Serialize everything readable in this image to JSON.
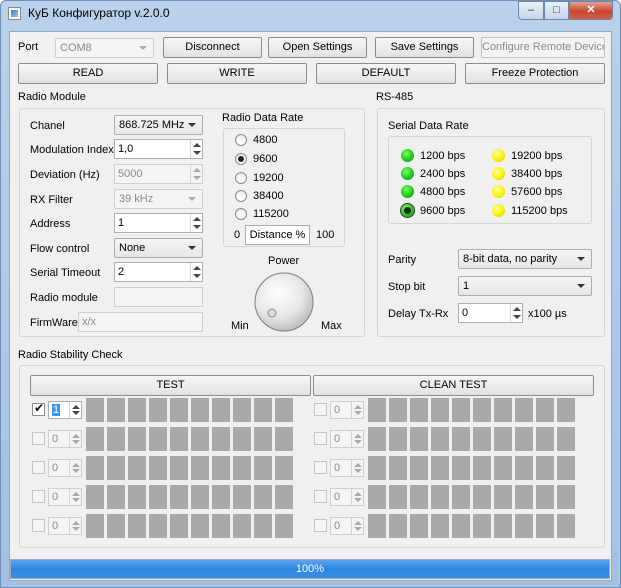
{
  "window": {
    "title": "КуБ Конфигуратор v.2.0.0",
    "buttons": {
      "minimize": "–",
      "maximize": "□",
      "close": "✕"
    }
  },
  "toolbar": {
    "port_label": "Port",
    "port_value": "COM8",
    "disconnect": "Disconnect",
    "open_settings": "Open Settings",
    "save_settings": "Save Settings",
    "configure_remote": "Configure Remote Device",
    "read": "READ",
    "write": "WRITE",
    "default": "DEFAULT",
    "freeze_protection": "Freeze Protection"
  },
  "radio_module": {
    "title": "Radio Module",
    "fields": {
      "chanel_label": "Chanel",
      "chanel_value": "868.725 MHz",
      "modulation_label": "Modulation Index",
      "modulation_value": "1,0",
      "deviation_label": "Deviation (Hz)",
      "deviation_value": "5000",
      "rx_filter_label": "RX Filter",
      "rx_filter_value": "39 kHz",
      "address_label": "Address",
      "address_value": "1",
      "flow_label": "Flow control",
      "flow_value": "None",
      "timeout_label": "Serial Timeout",
      "timeout_value": "2",
      "radio_module_label": "Radio module",
      "radio_module_value": "",
      "firmware_label": "FirmWare",
      "firmware_value": "x/x"
    },
    "data_rate": {
      "title": "Radio Data Rate",
      "options": [
        "4800",
        "9600",
        "19200",
        "38400",
        "115200"
      ],
      "selected": "9600",
      "distance_min": "0",
      "distance_label": "Distance %",
      "distance_max": "100"
    },
    "power": {
      "label": "Power",
      "min": "Min",
      "max": "Max"
    }
  },
  "rs485": {
    "title": "RS-485",
    "serial_rate_title": "Serial Data Rate",
    "rates_left": [
      "1200 bps",
      "2400 bps",
      "4800 bps",
      "9600 bps"
    ],
    "rates_right": [
      "19200 bps",
      "38400 bps",
      "57600 bps",
      "115200 bps"
    ],
    "selected": "9600 bps",
    "colors": {
      "green": "#18c318",
      "yellow": "#f5f000"
    },
    "parity_label": "Parity",
    "parity_value": "8-bit data, no parity",
    "stop_label": "Stop bit",
    "stop_value": "1",
    "delay_label": "Delay Tx-Rx",
    "delay_value": "0",
    "delay_unit": "x100 µs"
  },
  "stability": {
    "title": "Radio Stability Check",
    "test": "TEST",
    "clean_test": "CLEAN TEST",
    "left_rows": [
      {
        "checked": true,
        "value": "1"
      },
      {
        "checked": false,
        "value": "0"
      },
      {
        "checked": false,
        "value": "0"
      },
      {
        "checked": false,
        "value": "0"
      },
      {
        "checked": false,
        "value": "0"
      }
    ],
    "right_rows": [
      {
        "checked": false,
        "value": "0"
      },
      {
        "checked": false,
        "value": "0"
      },
      {
        "checked": false,
        "value": "0"
      },
      {
        "checked": false,
        "value": "0"
      },
      {
        "checked": false,
        "value": "0"
      }
    ],
    "cells_per_row": 10
  },
  "progress": {
    "text": "100%",
    "fraction": 1.0
  }
}
